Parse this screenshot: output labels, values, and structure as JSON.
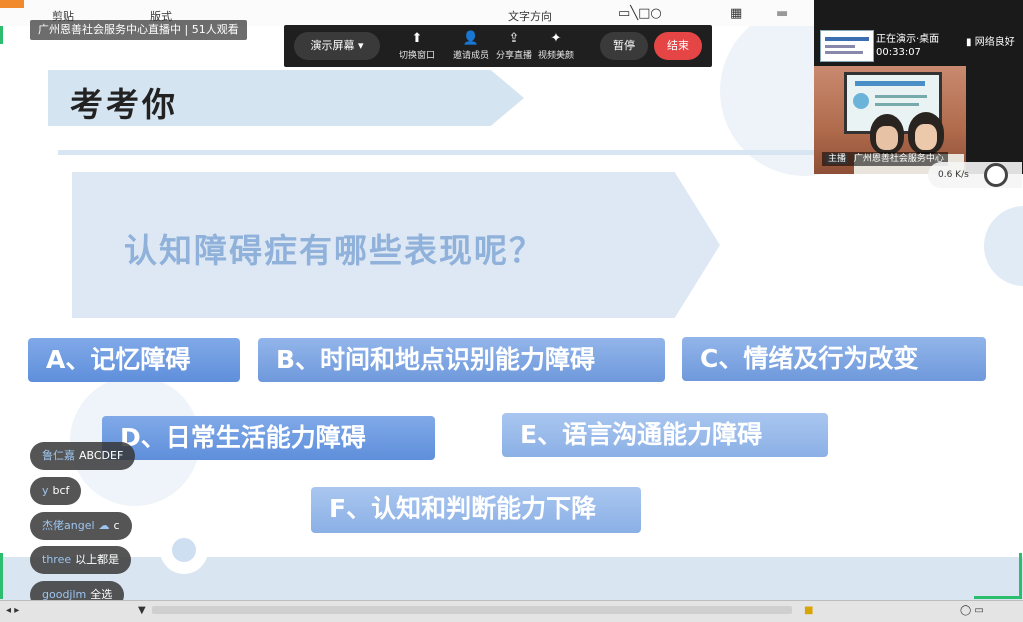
{
  "ribbon": {
    "items": [
      "剪贴",
      "版式",
      "文字方向"
    ]
  },
  "stream": {
    "live_tag": "广州恩善社会服务中心直播中 | 51人观看"
  },
  "meeting_bar": {
    "present_screen": "演示屏幕",
    "switch_window": "切换窗口",
    "invite_members": "邀请成员",
    "share_live": "分享直播",
    "video_beauty": "视频美颜",
    "pause": "暂停",
    "end": "结束"
  },
  "presenter": {
    "status_line1": "正在演示·桌面",
    "timer": "00:33:07",
    "network": "网络良好",
    "host_badge": "主播",
    "host_name": "广州恩善社会服务中心",
    "speed": "0.6 K/s"
  },
  "slide": {
    "title": "考考你",
    "question": "认知障碍症有哪些表现呢？",
    "options": [
      "A、记忆障碍",
      "B、时间和地点识别能力障碍",
      "C、情绪及行为改变",
      "D、日常生活能力障碍",
      "E、语言沟通能力障碍",
      "F、认知和判断能力下降"
    ]
  },
  "chat": [
    {
      "user": "鲁仁嘉",
      "message": "ABCDEF"
    },
    {
      "user": "y",
      "message": "bcf"
    },
    {
      "user": "杰佬angel",
      "message": "c"
    },
    {
      "user": "three",
      "message": "以上都是"
    },
    {
      "user": "goodjlm",
      "message": "全选"
    }
  ],
  "colors": {
    "accent_blue": "#6f99dc",
    "end_red": "#e64545",
    "green_frame": "#2dbd6e"
  }
}
